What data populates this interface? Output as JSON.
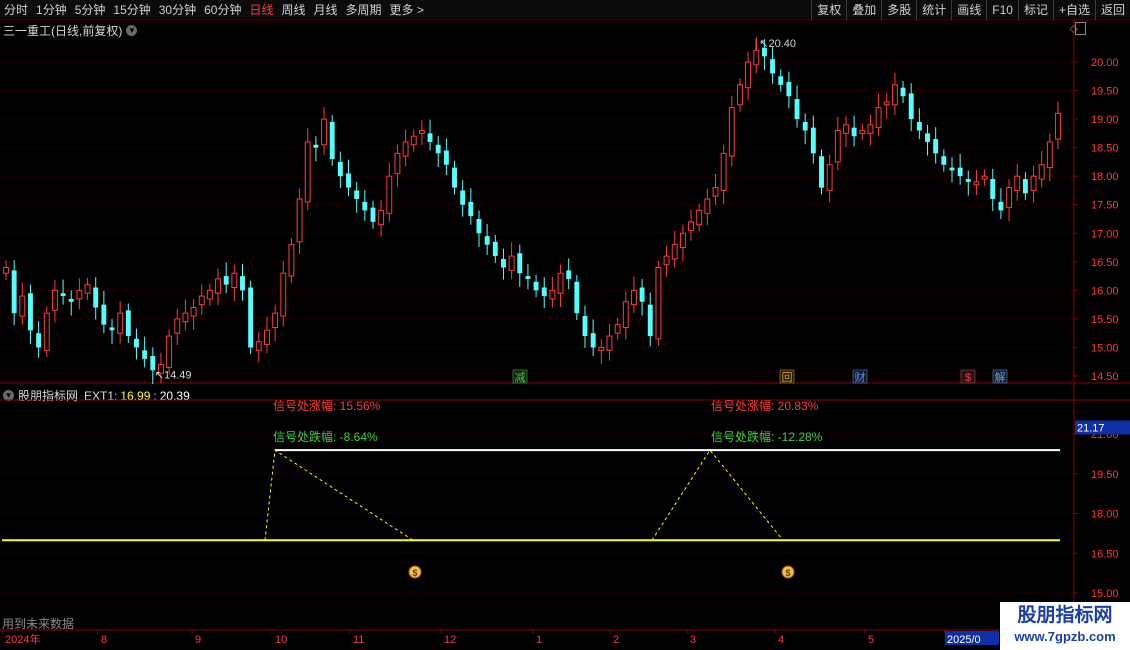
{
  "toolbar": {
    "periods": [
      "分时",
      "1分钟",
      "5分钟",
      "15分钟",
      "30分钟",
      "60分钟",
      "日线",
      "周线",
      "月线",
      "多周期",
      "更多 >"
    ],
    "active_index": 6,
    "right_buttons": [
      "复权",
      "叠加",
      "多股",
      "统计",
      "画线",
      "F10",
      "标记",
      "+自选",
      "返回"
    ]
  },
  "main_header": {
    "title": "三一重工(日线,前复权)",
    "icon": "chevron-down-icon"
  },
  "main_axis": {
    "labels": [
      "20.00",
      "19.50",
      "19.00",
      "18.50",
      "18.00",
      "17.50",
      "17.00",
      "16.50",
      "16.00",
      "15.50",
      "15.00",
      "14.50"
    ]
  },
  "main_annotations": {
    "high": "20.40",
    "low": "14.49"
  },
  "events": [
    {
      "label": "减",
      "color": "#3cd23c"
    },
    {
      "label": "回",
      "color": "#e8a030"
    },
    {
      "label": "财",
      "color": "#5a8cff"
    },
    {
      "label": "$",
      "color": "#ff3b3b"
    },
    {
      "label": "解",
      "color": "#5aa0ff"
    }
  ],
  "sub_header": {
    "name": "股朋指标网",
    "ext_label": "EXT1:",
    "ext_val1": "16.99",
    "ext_val2": "20.39"
  },
  "sub_axis": {
    "labels": [
      "21.00",
      "19.50",
      "18.00",
      "16.50",
      "15.00"
    ],
    "current": "21.17"
  },
  "signals": [
    {
      "top_text": "信号处涨幅: 15.56%",
      "bottom_text": "信号处跌幅: -8.64%"
    },
    {
      "top_text": "信号处涨幅: 20.83%",
      "bottom_text": "信号处跌幅: -12.28%"
    }
  ],
  "bottom_note": "用到未来数据",
  "x_axis": {
    "labels": [
      "2024年",
      "8",
      "9",
      "10",
      "11",
      "12",
      "1",
      "2",
      "3",
      "4",
      "5",
      "2025/0"
    ]
  },
  "watermark": {
    "line1": "股朋指标网",
    "line2": "www.7gpzb.com"
  },
  "colors": {
    "up": "#ff3b3b",
    "down": "#54ffff",
    "white_line": "#ffffff",
    "yellow_line": "#ffff00",
    "grid": "#800000"
  },
  "chart_data": {
    "type": "candlestick",
    "title": "三一重工(日线,前复权)",
    "ylim": [
      14.3,
      20.4
    ],
    "sub_ylim": [
      14.7,
      21.7
    ],
    "high_value": 20.4,
    "low_value": 14.49,
    "closes": [
      16.4,
      15.6,
      15.9,
      15.3,
      15.0,
      15.6,
      16.0,
      15.9,
      15.8,
      16.0,
      16.1,
      15.7,
      15.4,
      15.3,
      15.6,
      15.2,
      15.0,
      14.8,
      14.6,
      14.7,
      15.2,
      15.5,
      15.6,
      15.7,
      15.9,
      16.0,
      16.2,
      16.1,
      16.3,
      16.0,
      15.0,
      15.1,
      15.3,
      15.6,
      16.3,
      16.8,
      17.6,
      18.6,
      18.5,
      19.0,
      18.3,
      18.0,
      17.8,
      17.6,
      17.4,
      17.2,
      17.4,
      18.0,
      18.4,
      18.6,
      18.7,
      18.8,
      18.6,
      18.4,
      18.2,
      17.8,
      17.5,
      17.3,
      17.0,
      16.8,
      16.6,
      16.4,
      16.6,
      16.3,
      16.2,
      16.0,
      15.9,
      16.0,
      16.3,
      16.2,
      15.6,
      15.2,
      15.0,
      15.0,
      15.2,
      15.4,
      15.8,
      16.0,
      15.8,
      15.2,
      16.4,
      16.6,
      16.8,
      17.0,
      17.2,
      17.4,
      17.6,
      17.8,
      18.4,
      19.2,
      19.6,
      20.0,
      20.2,
      20.1,
      19.8,
      19.6,
      19.4,
      19.0,
      18.8,
      18.4,
      17.8,
      18.2,
      18.8,
      18.9,
      18.7,
      18.8,
      18.9,
      19.2,
      19.3,
      19.6,
      19.4,
      19.0,
      18.8,
      18.6,
      18.4,
      18.2,
      18.1,
      18.0,
      17.9,
      17.9,
      18.0,
      17.6,
      17.4,
      17.8,
      18.0,
      17.7,
      18.0,
      18.2,
      18.6,
      19.1
    ],
    "sub_lines": [
      {
        "name": "EXT1",
        "value": 16.99
      },
      {
        "name": "",
        "value": 20.39
      }
    ]
  }
}
